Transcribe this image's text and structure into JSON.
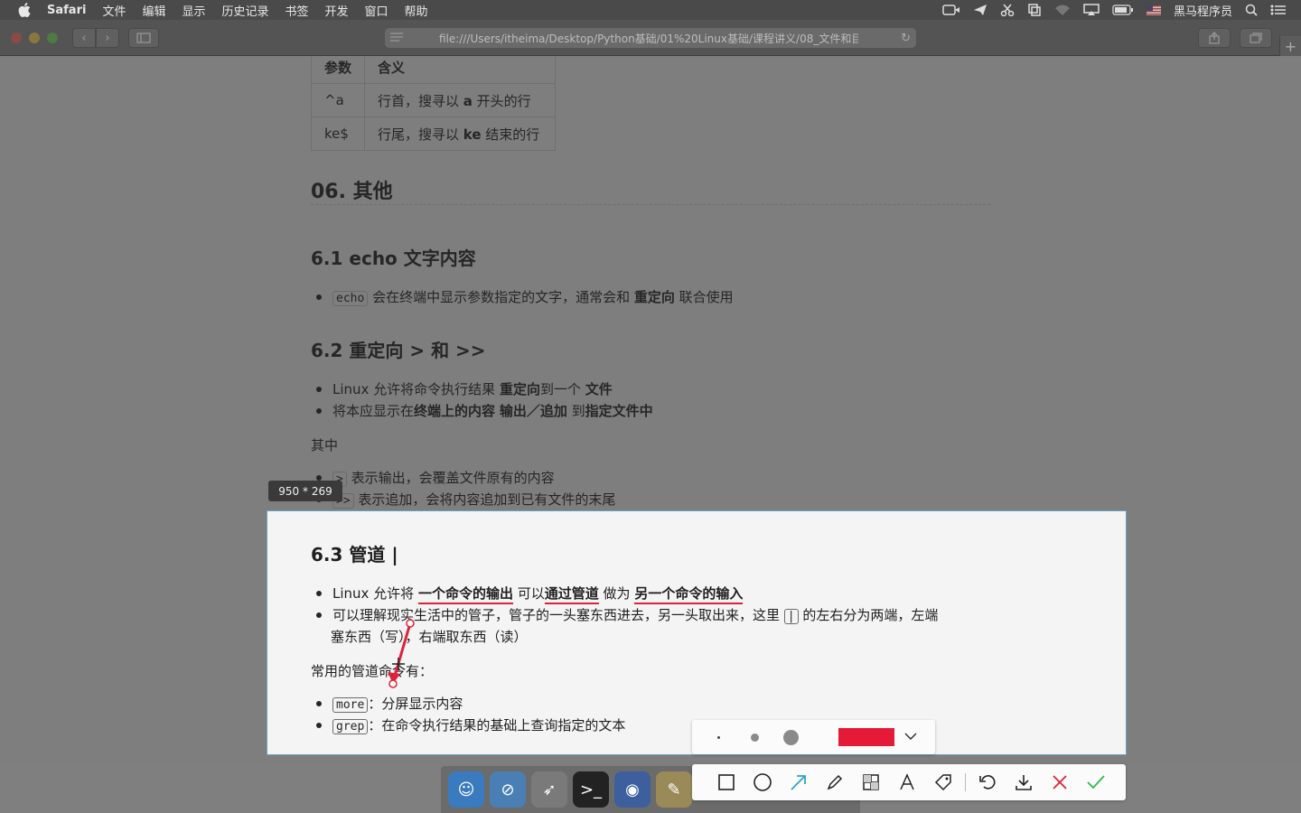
{
  "menubar": {
    "app_name": "Safari",
    "items": [
      "文件",
      "编辑",
      "显示",
      "历史记录",
      "书签",
      "开发",
      "窗口",
      "帮助"
    ],
    "user_name": "黑马程序员"
  },
  "toolbar": {
    "url": "file:///Users/itheima/Desktop/Python基础/01%20Linux基础/课程讲义/08_文件和目"
  },
  "doc": {
    "table": {
      "headers": [
        "参数",
        "含义"
      ],
      "rows": [
        {
          "param": "^a",
          "meaning_pre": "行首，搜寻以 ",
          "meaning_bold": "a",
          "meaning_post": " 开头的行"
        },
        {
          "param": "ke$",
          "meaning_pre": "行尾，搜寻以 ",
          "meaning_bold": "ke",
          "meaning_post": " 结束的行"
        }
      ]
    },
    "section_06": "06. 其他",
    "section_61": "6.1 echo 文字内容",
    "echo_li": {
      "code": "echo",
      "text": " 会在终端中显示参数指定的文字，通常会和 ",
      "bold": "重定向",
      "post": " 联合使用"
    },
    "section_62": "6.2 重定向 > 和 >>",
    "redirect_li1": {
      "pre": "Linux 允许将命令执行结果 ",
      "b1": "重定向",
      "mid": "到一个 ",
      "b2": "文件"
    },
    "redirect_li2": {
      "pre": "将本应显示在",
      "b1": "终端上的内容",
      "mid": " ",
      "b2": "输出／追加",
      "mid2": " 到",
      "b3": "指定文件中"
    },
    "other_label": "其中",
    "gt_li": {
      "code": ">",
      "text": " 表示输出，会覆盖文件原有的内容"
    },
    "gtgt_li": {
      "code": ">>",
      "text": " 表示追加，会将内容追加到已有文件的末尾"
    }
  },
  "size_indicator": "950 * 269",
  "selection": {
    "section_63": "6.3 管道 |",
    "pipe_li1": {
      "pre": "Linux 允许将 ",
      "b1": "一个命令的输出",
      "mid": " 可以",
      "b2": "通过管道",
      "mid2": " 做为 ",
      "b3": "另一个命令的输入"
    },
    "pipe_li2_a": "可以理解现实生活中的管子，管子的一头塞东西进去，另一头取出来，这里 ",
    "pipe_li2_code": "|",
    "pipe_li2_b": " 的左右分为两端，左端",
    "pipe_li2_c": "塞东西（写），右端取东西（读）",
    "common_label": "常用的管道命令有：",
    "more_li": {
      "code": "more",
      "text": "：分屏显示内容"
    },
    "grep_li": {
      "code": "grep",
      "text": "：在命令执行结果的基础上查询指定的文本"
    }
  },
  "annotation": {
    "selected_color": "#e51a37",
    "tools": [
      "rectangle-icon",
      "ellipse-icon",
      "arrow-icon",
      "pen-icon",
      "mosaic-icon",
      "text-icon",
      "tag-icon",
      "undo-icon",
      "download-icon",
      "cancel-icon",
      "confirm-icon"
    ]
  }
}
